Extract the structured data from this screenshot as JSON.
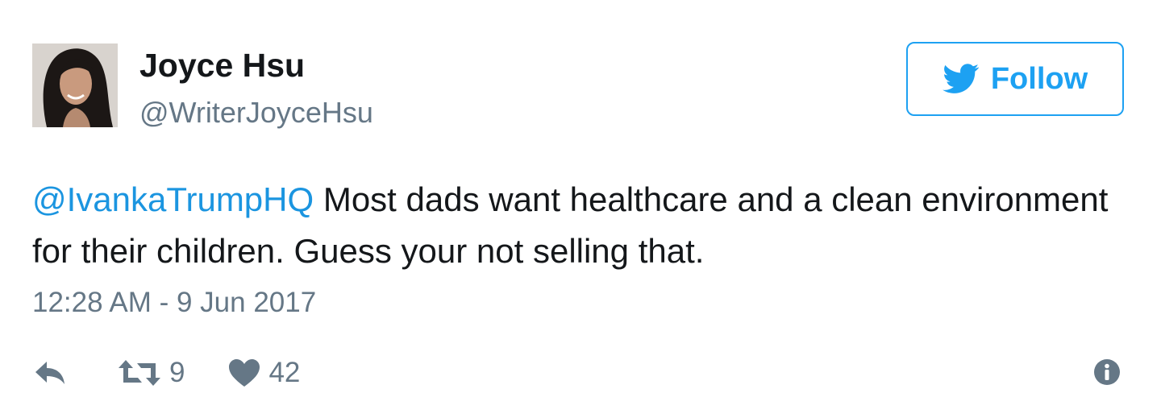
{
  "author": {
    "name": "Joyce Hsu",
    "handle": "@WriterJoyceHsu"
  },
  "follow": {
    "label": "Follow",
    "icon": "twitter-bird-icon"
  },
  "tweet": {
    "mention": "@IvankaTrumpHQ",
    "text": " Most dads want healthcare and a clean environment for their children. Guess your not selling that.",
    "timestamp": "12:28 AM - 9 Jun 2017"
  },
  "actions": {
    "reply_icon": "reply-icon",
    "retweet_icon": "retweet-icon",
    "retweet_count": "9",
    "like_icon": "heart-icon",
    "like_count": "42",
    "info_icon": "info-icon"
  },
  "colors": {
    "accent": "#1da1f2",
    "mention": "#1b95e0",
    "text": "#14171a",
    "muted": "#657786"
  }
}
